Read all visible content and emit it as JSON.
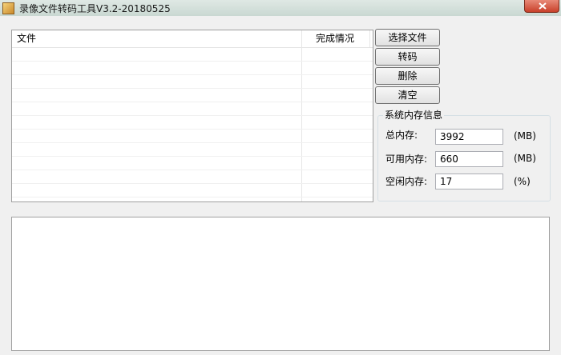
{
  "window": {
    "title": "录像文件转码工具V3.2-20180525",
    "icon": "app-icon",
    "close_icon": "close-icon"
  },
  "file_list": {
    "columns": [
      "文件",
      "完成情况"
    ],
    "rows": []
  },
  "buttons": {
    "select_file": "选择文件",
    "transcode": "转码",
    "delete": "删除",
    "clear": "清空"
  },
  "memory": {
    "group_title": "系统内存信息",
    "total_label": "总内存:",
    "total_value": "3992",
    "total_unit": "(MB)",
    "available_label": "可用内存:",
    "available_value": "660",
    "available_unit": "(MB)",
    "free_label": "空闲内存:",
    "free_value": "17",
    "free_unit": "(%)"
  },
  "log": {
    "text": ""
  },
  "colors": {
    "title_bar": "#c9d8d2",
    "close_button": "#c8402a",
    "background": "#f0f0f0"
  }
}
